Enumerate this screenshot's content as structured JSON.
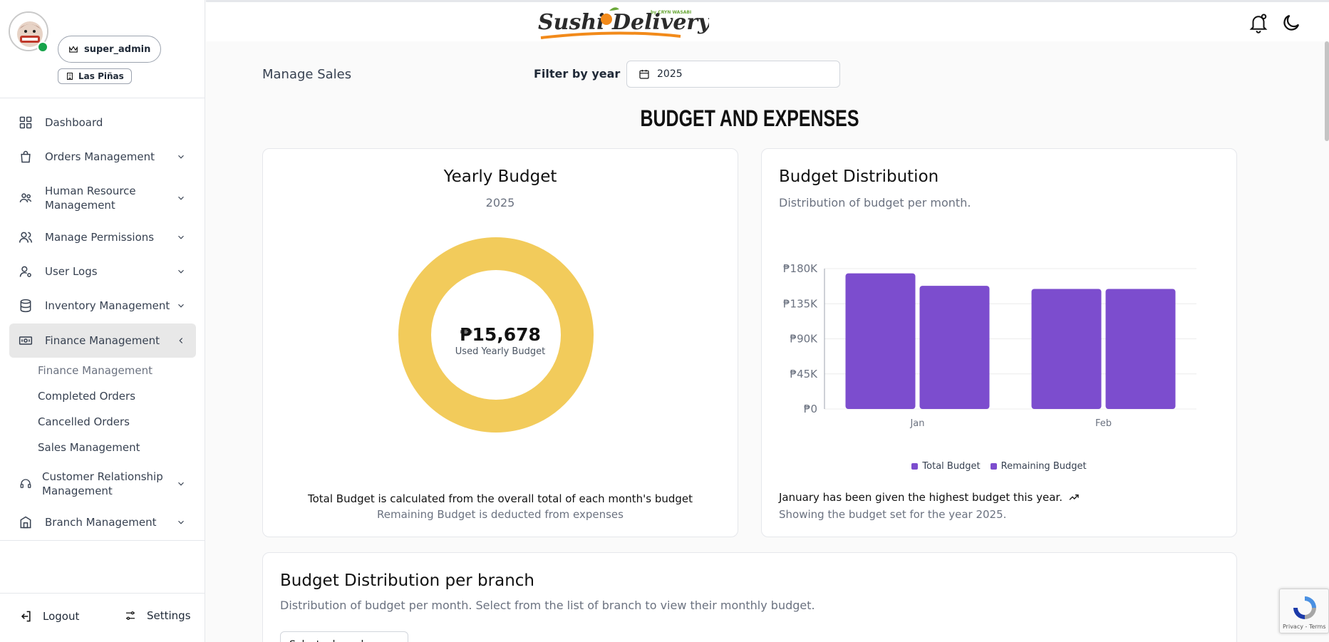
{
  "colors": {
    "accent": "#7c4dce",
    "donut": "#f2cb5b",
    "online": "#16a34a"
  },
  "user": {
    "role": "super_admin",
    "branch": "Las Piñas"
  },
  "nav": {
    "items": [
      {
        "label": "Dashboard",
        "icon": "grid-icon"
      },
      {
        "label": "Orders Management",
        "icon": "shopping-bag-icon"
      },
      {
        "label": "Human Resource Management",
        "icon": "users-gear-icon"
      },
      {
        "label": "Manage Permissions",
        "icon": "users-icon"
      },
      {
        "label": "User Logs",
        "icon": "user-cog-icon"
      },
      {
        "label": "Inventory Management",
        "icon": "database-icon"
      },
      {
        "label": "Finance Management",
        "icon": "banknote-icon"
      },
      {
        "label": "Customer Relationship Management",
        "icon": "headset-icon"
      },
      {
        "label": "Branch Management",
        "icon": "building-icon"
      }
    ],
    "finance_sub": [
      "Finance Management",
      "Completed Orders",
      "Cancelled Orders",
      "Sales Management"
    ]
  },
  "footer": {
    "logout": "Logout",
    "settings": "Settings"
  },
  "header": {
    "logo_text": "Sushi Delivery",
    "logo_tag": "by CRYN WASABI"
  },
  "filter": {
    "page_label": "Manage Sales",
    "label": "Filter by year",
    "year": "2025"
  },
  "main_title": "BUDGET AND EXPENSES",
  "yearly": {
    "title": "Yearly Budget",
    "year": "2025",
    "value": "₱15,678",
    "caption": "Used Yearly Budget",
    "note1": "Total Budget is calculated from the overall total of each month's budget",
    "note2": "Remaining Budget is deducted from expenses"
  },
  "distribution": {
    "title": "Budget Distribution",
    "subtitle": "Distribution of budget per month.",
    "note1": "January has been given the highest budget this year.",
    "note2": "Showing the budget set for the year 2025."
  },
  "chart_data": {
    "type": "bar",
    "categories": [
      "Jan",
      "Feb"
    ],
    "series": [
      {
        "name": "Total Budget",
        "values": [
          174000,
          154000
        ]
      },
      {
        "name": "Remaining Budget",
        "values": [
          158000,
          154000
        ]
      }
    ],
    "ylim": [
      0,
      180000
    ],
    "yticks": [
      "₱0",
      "₱45K",
      "₱90K",
      "₱135K",
      "₱180K"
    ],
    "grid": true,
    "legend": "bottom"
  },
  "branch": {
    "title": "Budget Distribution per branch",
    "subtitle": "Distribution of budget per month. Select from the list of branch to view their monthly budget.",
    "select_text": "Select a branch"
  },
  "recaptcha": {
    "text": "Privacy - Terms"
  }
}
